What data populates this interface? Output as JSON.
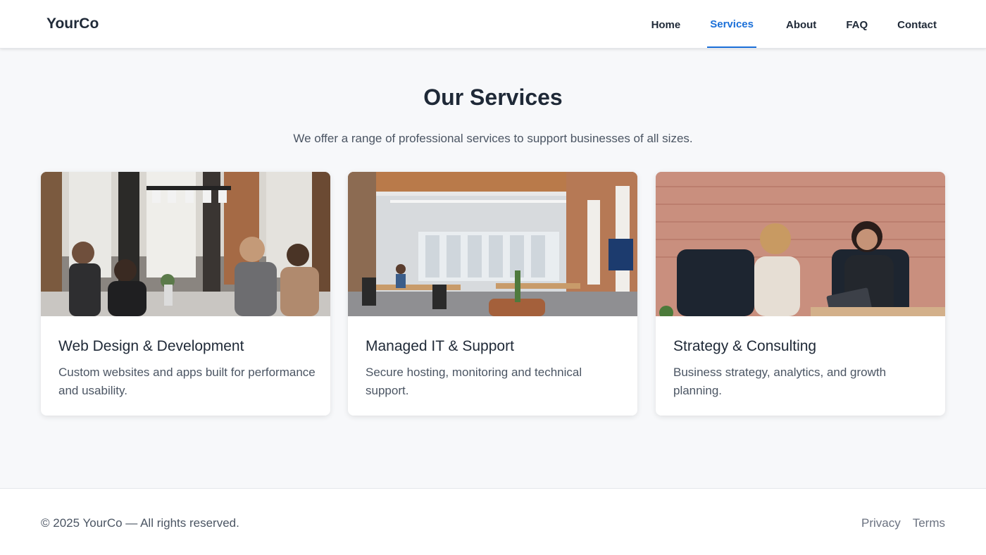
{
  "header": {
    "logo": "YourCo",
    "nav": [
      {
        "label": "Home",
        "active": false
      },
      {
        "label": "Services",
        "active": true
      },
      {
        "label": "About",
        "active": false
      },
      {
        "label": "FAQ",
        "active": false
      },
      {
        "label": "Contact",
        "active": false
      }
    ],
    "accent_color": "#1a6fd8"
  },
  "main": {
    "title": "Our Services",
    "subtitle": "We offer a range of professional services to support businesses of all sizes.",
    "cards": [
      {
        "title": "Web Design & Development",
        "description": "Custom websites and apps built for performance and usability.",
        "image": "team-working-photo"
      },
      {
        "title": "Managed IT & Support",
        "description": "Secure hosting, monitoring and technical support.",
        "image": "office-space-photo"
      },
      {
        "title": "Strategy & Consulting",
        "description": "Business strategy, analytics, and growth planning.",
        "image": "consulting-meeting-photo"
      }
    ]
  },
  "footer": {
    "copyright": "© 2025 YourCo — All rights reserved.",
    "links": [
      {
        "label": "Privacy"
      },
      {
        "label": "Terms"
      }
    ]
  }
}
